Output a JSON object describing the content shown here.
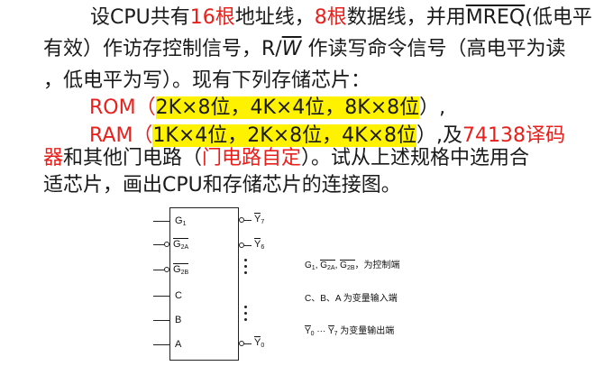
{
  "text": {
    "l1_a": "设CPU共有",
    "l1_b": "16根",
    "l1_c": "地址线，",
    "l1_d": "8根",
    "l1_e": "数据线，并用",
    "l1_f": "MREQ",
    "l1_g": "(低电平",
    "l2_a": "有效）作访存控制信号，R/",
    "l2_b": "W",
    "l2_c": " 作读写命令信号（高电平为读",
    "l3": "，低电平为写）。现有下列存储芯片：",
    "l4_a": "ROM（",
    "l4_b": "2K×8位，4K×4位，8K×8位",
    "l4_c": "）,",
    "l5_a": "RAM（",
    "l5_b": "1K×4位，2K×8位，4K×8位",
    "l5_c": "）,及",
    "l5_d": "74138译码",
    "l6_a": "器",
    "l6_b": "和其他门电路（",
    "l6_c": "门电路自定",
    "l6_d": "）。试从上述规格中选用合",
    "l7": "适芯片，画出CPU和存储芯片的连接图。"
  },
  "diagram": {
    "left_pins": [
      {
        "label": "G",
        "sub": "1",
        "overline": false,
        "bubble": false
      },
      {
        "label": "G",
        "sub": "2A",
        "overline": true,
        "bubble": true
      },
      {
        "label": "G",
        "sub": "2B",
        "overline": true,
        "bubble": true
      },
      {
        "label": "C",
        "sub": "",
        "overline": false,
        "bubble": false
      },
      {
        "label": "B",
        "sub": "",
        "overline": false,
        "bubble": false
      },
      {
        "label": "A",
        "sub": "",
        "overline": false,
        "bubble": false
      }
    ],
    "right_pins": [
      {
        "label": "Y",
        "sub": "7"
      },
      {
        "label": "Y",
        "sub": "6"
      },
      {
        "label": "Y",
        "sub": "0"
      }
    ],
    "legend": {
      "l1_a": "G",
      "l1_a_sub": "1",
      "l1_b": "G",
      "l1_b_sub": "2A",
      "l1_c": "G",
      "l1_c_sub": "2B",
      "l1_text": "，为控制端",
      "l2": "C、B、A  为变量输入端",
      "l3_a": "Y",
      "l3_a_sub": "0",
      "l3_mid": " ··· ",
      "l3_b": "Y",
      "l3_b_sub": "7",
      "l3_text": "  为变量输出端"
    }
  }
}
